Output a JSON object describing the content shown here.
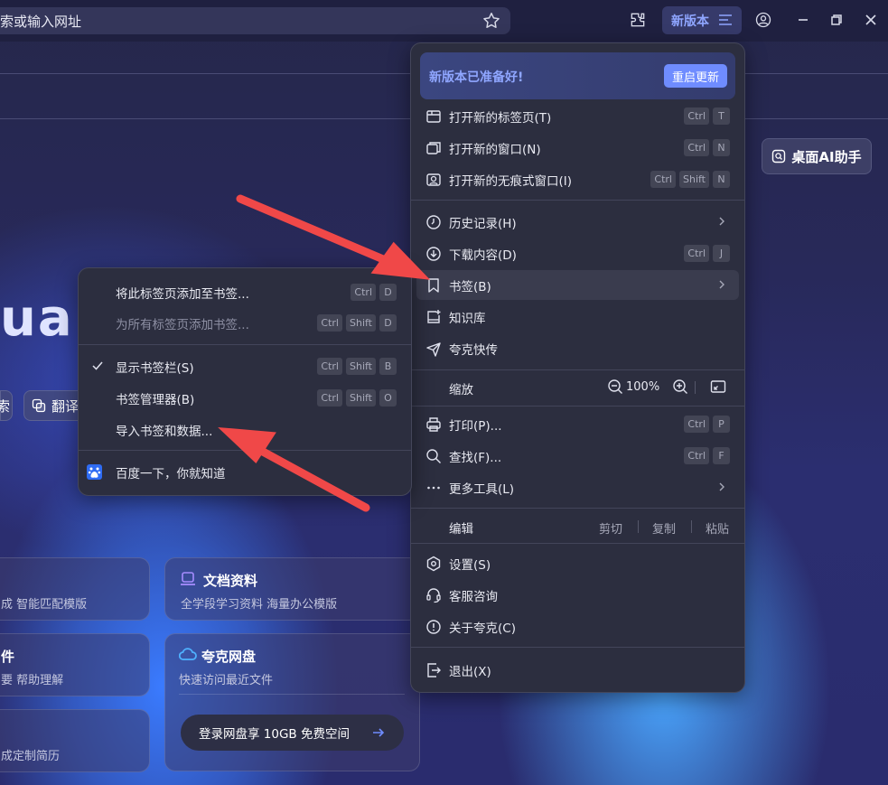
{
  "address_bar": {
    "text": "索或输入网址"
  },
  "toolbar": {
    "new_version_label": "新版本"
  },
  "page": {
    "logo_fragment": "uar",
    "ai_button": "桌面AI助手",
    "pill_left": "索",
    "pill_translate": "翻译",
    "cards": {
      "left1_sub": "成 智能匹配模版",
      "left2_title": "件",
      "left2_sub": "要 帮助理解",
      "left3_sub": "成定制简历",
      "docs_title": "文档资料",
      "docs_sub": "全学段学习资料 海量办公模版",
      "disk_title": "夸克网盘",
      "disk_sub": "快速访问最近文件",
      "disk_login": "登录网盘享 10GB 免费空间"
    }
  },
  "menu": {
    "update_title": "新版本已准备好!",
    "update_button": "重启更新",
    "items": [
      {
        "label": "打开新的标签页(T)",
        "keys": [
          "Ctrl",
          "T"
        ]
      },
      {
        "label": "打开新的窗口(N)",
        "keys": [
          "Ctrl",
          "N"
        ]
      },
      {
        "label": "打开新的无痕式窗口(I)",
        "keys": [
          "Ctrl",
          "Shift",
          "N"
        ]
      },
      {
        "label": "历史记录(H)"
      },
      {
        "label": "下载内容(D)",
        "keys": [
          "Ctrl",
          "J"
        ]
      },
      {
        "label": "书签(B)"
      },
      {
        "label": "知识库"
      },
      {
        "label": "夸克快传"
      },
      {
        "label": "打印(P)...",
        "keys": [
          "Ctrl",
          "P"
        ]
      },
      {
        "label": "查找(F)...",
        "keys": [
          "Ctrl",
          "F"
        ]
      },
      {
        "label": "更多工具(L)"
      },
      {
        "label": "设置(S)"
      },
      {
        "label": "客服咨询"
      },
      {
        "label": "关于夸克(C)"
      },
      {
        "label": "退出(X)"
      }
    ],
    "zoom_label": "缩放",
    "zoom_value": "100%",
    "edit_label": "编辑",
    "edit_cut": "剪切",
    "edit_copy": "复制",
    "edit_paste": "粘贴"
  },
  "submenu": {
    "items": [
      {
        "label": "将此标签页添加至书签...",
        "keys": [
          "Ctrl",
          "D"
        ]
      },
      {
        "label": "为所有标签页添加书签...",
        "keys": [
          "Ctrl",
          "Shift",
          "D"
        ]
      },
      {
        "label": "显示书签栏(S)",
        "keys": [
          "Ctrl",
          "Shift",
          "B"
        ]
      },
      {
        "label": "书签管理器(B)",
        "keys": [
          "Ctrl",
          "Shift",
          "O"
        ]
      },
      {
        "label": "导入书签和数据..."
      },
      {
        "label": "百度一下，你就知道"
      }
    ]
  },
  "colors": {
    "accent": "#6f8cff",
    "menu_bg": "#2c2e3f",
    "annotation_arrow": "#f04848"
  }
}
